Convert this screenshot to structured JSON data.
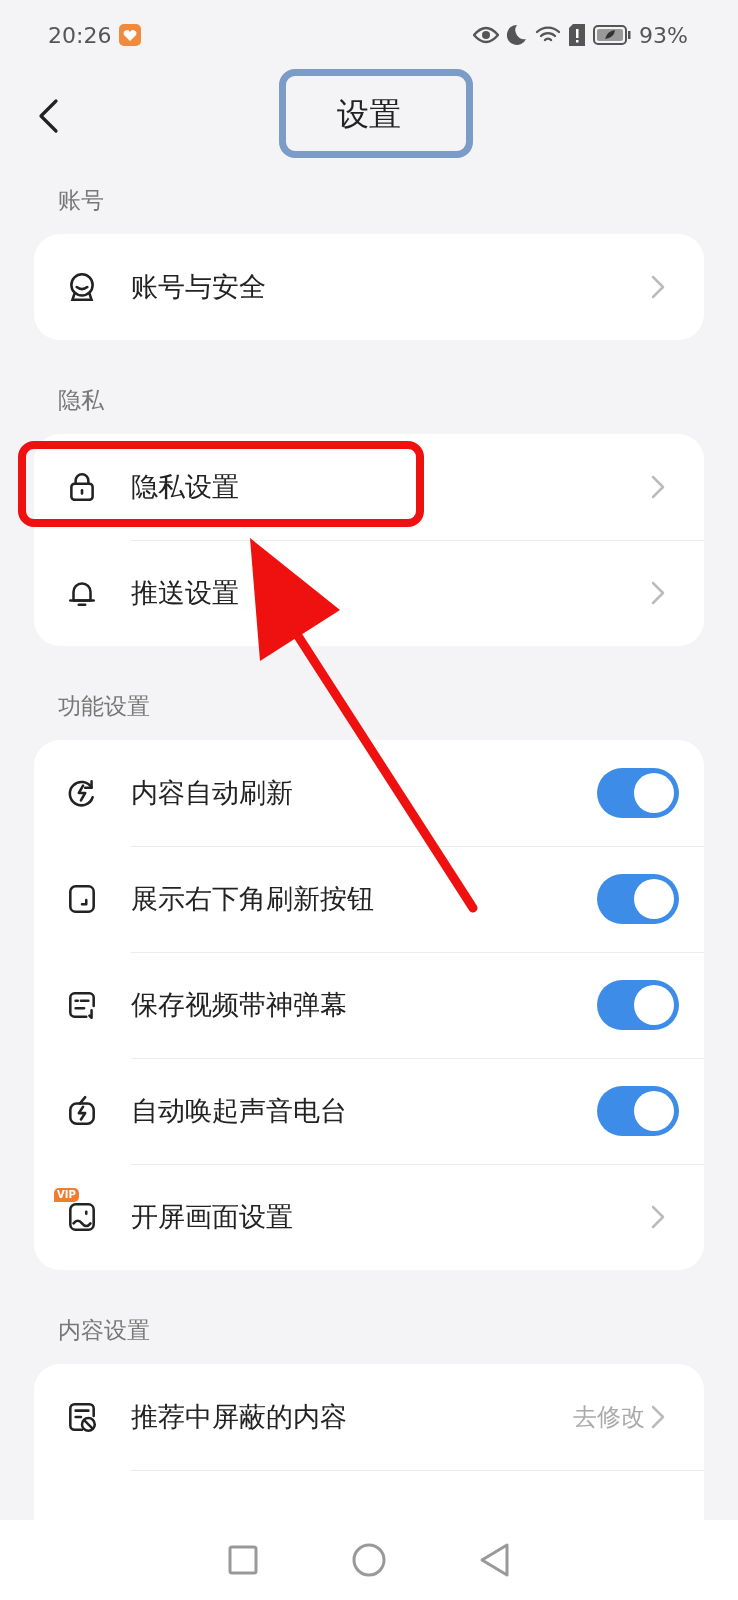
{
  "status_bar": {
    "time": "20:26",
    "battery": "93%"
  },
  "header": {
    "title": "设置"
  },
  "sections": [
    {
      "label": "账号",
      "items": [
        {
          "kind": "link",
          "label": "账号与安全"
        }
      ]
    },
    {
      "label": "隐私",
      "items": [
        {
          "kind": "link",
          "label": "隐私设置"
        },
        {
          "kind": "link",
          "label": "推送设置"
        }
      ]
    },
    {
      "label": "功能设置",
      "items": [
        {
          "kind": "toggle",
          "label": "内容自动刷新",
          "on": true
        },
        {
          "kind": "toggle",
          "label": "展示右下角刷新按钮",
          "on": true
        },
        {
          "kind": "toggle",
          "label": "保存视频带神弹幕",
          "on": true
        },
        {
          "kind": "toggle",
          "label": "自动唤起声音电台",
          "on": true
        },
        {
          "kind": "link",
          "badge": "VIP",
          "label": "开屏画面设置"
        }
      ]
    },
    {
      "label": "内容设置",
      "items": [
        {
          "kind": "link",
          "label": "推荐中屏蔽的内容",
          "value": "去修改"
        },
        {
          "kind": "hidden"
        }
      ]
    }
  ]
}
